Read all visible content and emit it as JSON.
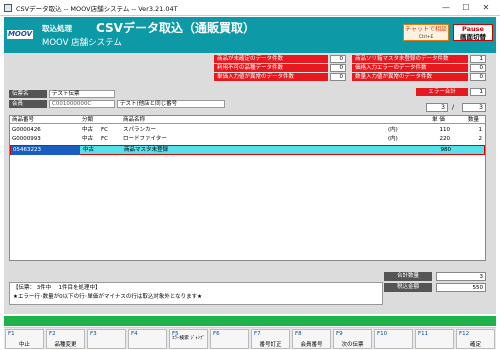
{
  "window": {
    "title": "CSVデータ取込 -- MOOV店舗システム -- Ver3.21.04T",
    "controls": [
      "—",
      "☐",
      "✕"
    ]
  },
  "header": {
    "logo_text": "MOOV",
    "process_label": "取込処理",
    "main_title": "CSVデータ取込（通販買取）",
    "system_name": "MOOV 店舗システム",
    "chat_button": {
      "label": "チャットで相談",
      "sub": "Ctrl+E"
    },
    "pause_button": {
      "label": "Pause",
      "sub": "画面切替"
    }
  },
  "stats": [
    {
      "label": "商品が未確定のデータ件数",
      "value": "0"
    },
    {
      "label": "利用不可の品種データ件数",
      "value": "0"
    },
    {
      "label": "単価入力値が異常のデータ件数",
      "value": "0"
    },
    {
      "label": "商品ソリ箱マスタ未登録のデータ件数",
      "value": "1"
    },
    {
      "label": "価格入力エラーのデータ件数",
      "value": "0"
    },
    {
      "label": "数量入力値が異常のデータ件数",
      "value": "0"
    }
  ],
  "error_total": {
    "label": "エラー合計",
    "value": "1"
  },
  "slip": {
    "label": "伝票名",
    "value": "テスト伝票"
  },
  "member": {
    "label": "会員",
    "code": "C001000000C",
    "name": "テスト(他店と同じ番号"
  },
  "paging": {
    "current": "3",
    "separator": "/",
    "total": "3"
  },
  "grid": {
    "headers": {
      "code": "商品番号",
      "category": "分類",
      "name": "商品名称",
      "price": "単 価",
      "qty": "数量"
    },
    "rows": [
      {
        "code": "G0000426",
        "cond": "中古",
        "type": "FC",
        "name": "スパランカー",
        "tax": "(内)",
        "price": "110",
        "qty": "1"
      },
      {
        "code": "G0000993",
        "cond": "中古",
        "type": "FC",
        "name": "ロードファイター",
        "tax": "(内)",
        "price": "220",
        "qty": "2"
      },
      {
        "code": "05463223",
        "cond": "中古",
        "type": "",
        "name": "商品マスタ未登録",
        "tax": "",
        "price": "980",
        "qty": ""
      }
    ]
  },
  "status_message": {
    "line1": "【伝票： 3件中 　1件目を処理中】",
    "line2": "★エラー行･数量が0以下の行･単価がマイナスの行は取込対象外となります★"
  },
  "totals": {
    "qty_label": "合計数量",
    "qty_value": "3",
    "amount_label": "税込金額",
    "amount_value": "550"
  },
  "fkeys": [
    {
      "num": "F1",
      "label": "中止"
    },
    {
      "num": "F2",
      "label": "品種変更"
    },
    {
      "num": "F3",
      "label": ""
    },
    {
      "num": "F4",
      "label": ""
    },
    {
      "num": "F5",
      "label": "ｴﾗｰ検索 ｼﾞｬﾝﾌﾟ"
    },
    {
      "num": "F6",
      "label": ""
    },
    {
      "num": "F7",
      "label": "番号訂正"
    },
    {
      "num": "F8",
      "label": "会員番号"
    },
    {
      "num": "F9",
      "label": "次の伝票"
    },
    {
      "num": "F10",
      "label": ""
    },
    {
      "num": "F11",
      "label": ""
    },
    {
      "num": "F12",
      "label": "確定"
    }
  ],
  "colors": {
    "header": "#0d9aa6",
    "alert": "#e8191e",
    "selected_row": "#56e0ea",
    "fkey_bar": "#1db34a"
  }
}
